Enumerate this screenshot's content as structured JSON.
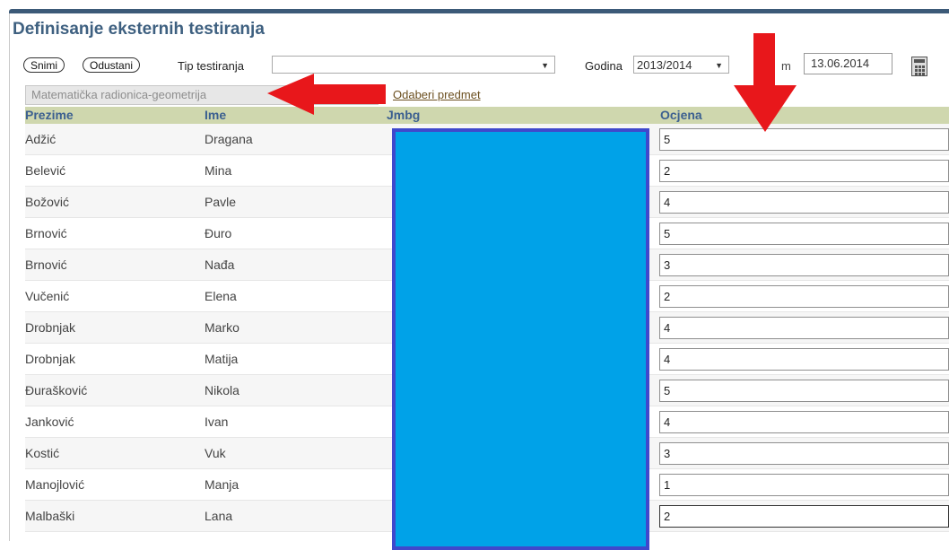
{
  "title": "Definisanje eksternih testiranja",
  "toolbar": {
    "save_label": "Snimi",
    "cancel_label": "Odustani",
    "test_type_label": "Tip testiranja",
    "test_type_value": "",
    "year_label": "Godina",
    "year_value": "2013/2014",
    "date_label": "m",
    "date_value": "13.06.2014"
  },
  "subject": {
    "value": "Matematička radionica-geometrija",
    "choose_link": "Odaberi predmet"
  },
  "table": {
    "headers": [
      "Prezime",
      "Ime",
      "Jmbg",
      "Ocjena"
    ],
    "rows": [
      {
        "prezime": "Adžić",
        "ime": "Dragana",
        "ocjena": "5"
      },
      {
        "prezime": "Belević",
        "ime": "Mina",
        "ocjena": "2"
      },
      {
        "prezime": "Božović",
        "ime": "Pavle",
        "ocjena": "4"
      },
      {
        "prezime": "Brnović",
        "ime": "Đuro",
        "ocjena": "5"
      },
      {
        "prezime": "Brnović",
        "ime": "Nađa",
        "ocjena": "3"
      },
      {
        "prezime": "Vučenić",
        "ime": "Elena",
        "ocjena": "2"
      },
      {
        "prezime": "Drobnjak",
        "ime": "Marko",
        "ocjena": "4"
      },
      {
        "prezime": "Drobnjak",
        "ime": "Matija",
        "ocjena": "4"
      },
      {
        "prezime": "Đurašković",
        "ime": "Nikola",
        "ocjena": "5"
      },
      {
        "prezime": "Janković",
        "ime": "Ivan",
        "ocjena": "4"
      },
      {
        "prezime": "Kostić",
        "ime": "Vuk",
        "ocjena": "3"
      },
      {
        "prezime": "Manojlović",
        "ime": "Manja",
        "ocjena": "1"
      },
      {
        "prezime": "Malbaški",
        "ime": "Lana",
        "ocjena": "2"
      }
    ]
  },
  "colors": {
    "title": "#3e6080",
    "header_bg": "#cfd7ae",
    "redaction_fill": "#00a2e8",
    "redaction_border": "#3f48cc",
    "annotation_arrow": "#e8171b"
  }
}
